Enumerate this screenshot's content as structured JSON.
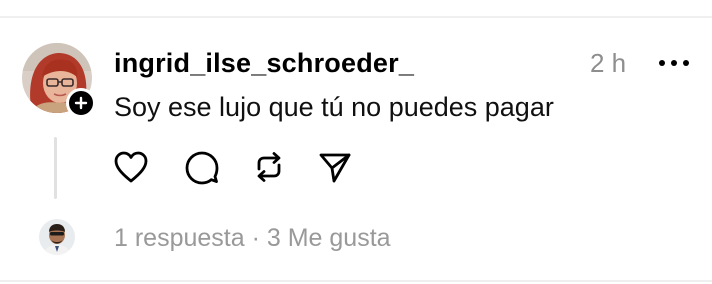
{
  "post": {
    "username": "ingrid_ilse_schroeder_",
    "timestamp": "2 h",
    "text": "Soy ese lujo que tú no puedes pagar"
  },
  "icons": {
    "follow": "plus-icon",
    "more": "more-horizontal-icon",
    "like": "heart-icon",
    "reply": "comment-bubble-icon",
    "repost": "repost-icon",
    "share": "send-icon"
  },
  "stats": {
    "replies": "1 respuesta",
    "separator": " · ",
    "likes": "3 Me gusta"
  },
  "colors": {
    "text": "#000000",
    "secondary": "#8e8e8e",
    "divider": "#f0f0f0",
    "thread_line": "#e1e1e1"
  }
}
